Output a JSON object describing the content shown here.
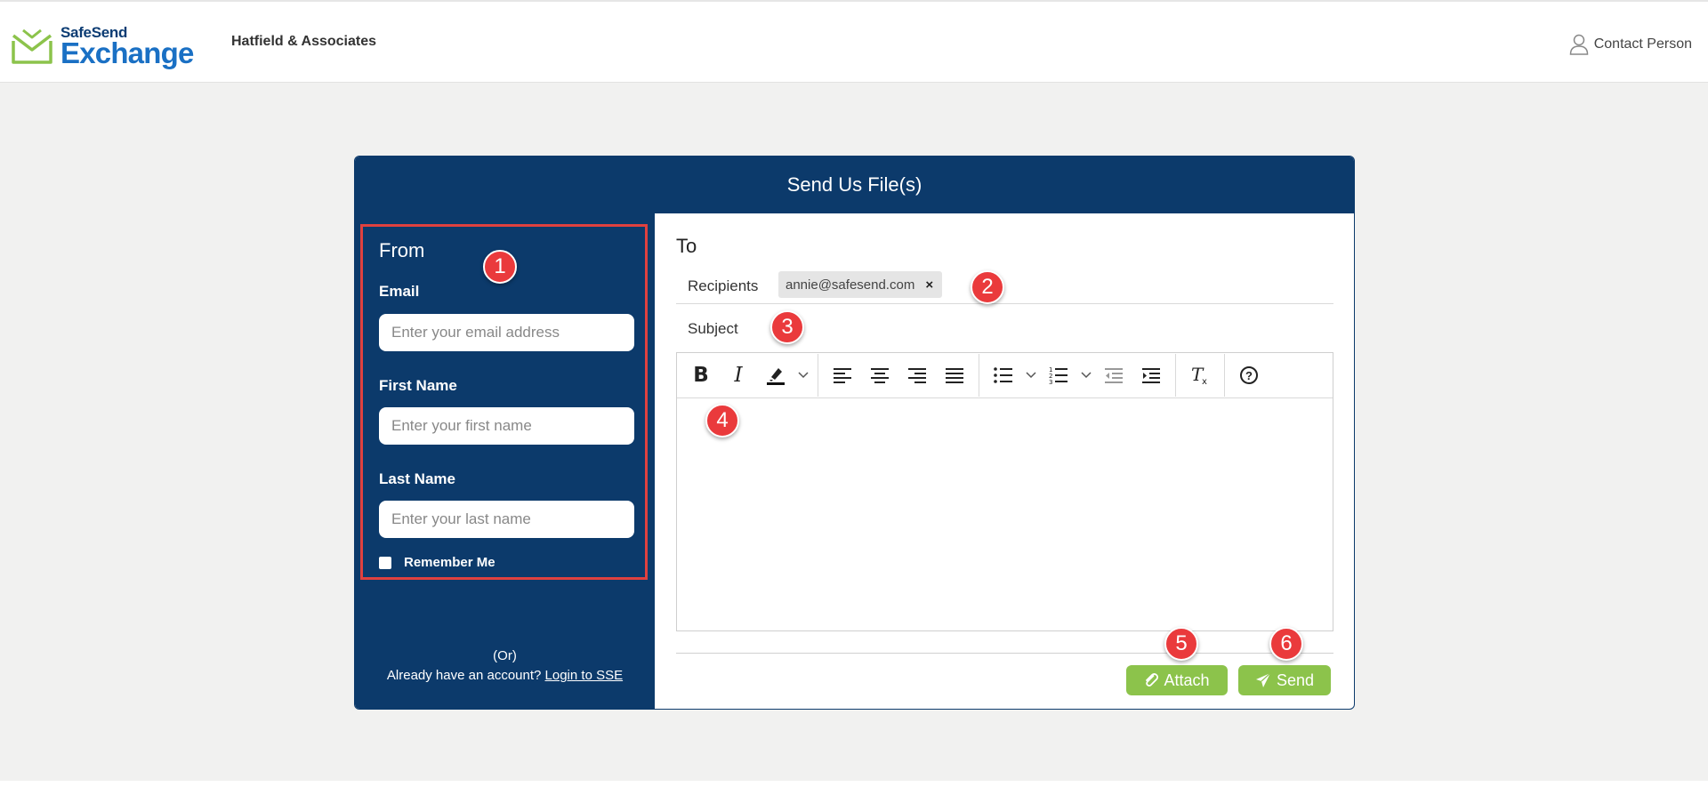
{
  "header": {
    "logo_top": "SafeSend",
    "logo_bottom": "Exchange",
    "firm_name": "Hatfield & Associates",
    "contact_label": "Contact Person"
  },
  "card": {
    "title": "Send Us File(s)"
  },
  "from": {
    "title": "From",
    "email_label": "Email",
    "email_placeholder": "Enter your email address",
    "first_name_label": "First Name",
    "first_name_placeholder": "Enter your first name",
    "last_name_label": "Last Name",
    "last_name_placeholder": "Enter your last name",
    "remember_label": "Remember Me",
    "or_text": "(Or)",
    "account_prompt": "Already have an account?",
    "login_link": "Login to SSE"
  },
  "to": {
    "title": "To",
    "recipients_label": "Recipients",
    "recipient_chip": "annie@safesend.com",
    "chip_remove": "×",
    "subject_label": "Subject"
  },
  "toolbar": {
    "bold": "B",
    "italic": "I",
    "help": "?",
    "icons": [
      "bold-icon",
      "italic-icon",
      "highlight-icon",
      "align-left-icon",
      "align-center-icon",
      "align-right-icon",
      "align-justify-icon",
      "bullet-list-icon",
      "numbered-list-icon",
      "outdent-icon",
      "indent-icon",
      "clear-format-icon",
      "help-icon"
    ]
  },
  "actions": {
    "attach_label": "Attach",
    "send_label": "Send"
  },
  "badges": [
    "1",
    "2",
    "3",
    "4",
    "5",
    "6"
  ],
  "colors": {
    "navy": "#0c3a6b",
    "green": "#8cc34b",
    "badge_red": "#ea3a3c",
    "highlight_red": "#e0413f"
  }
}
